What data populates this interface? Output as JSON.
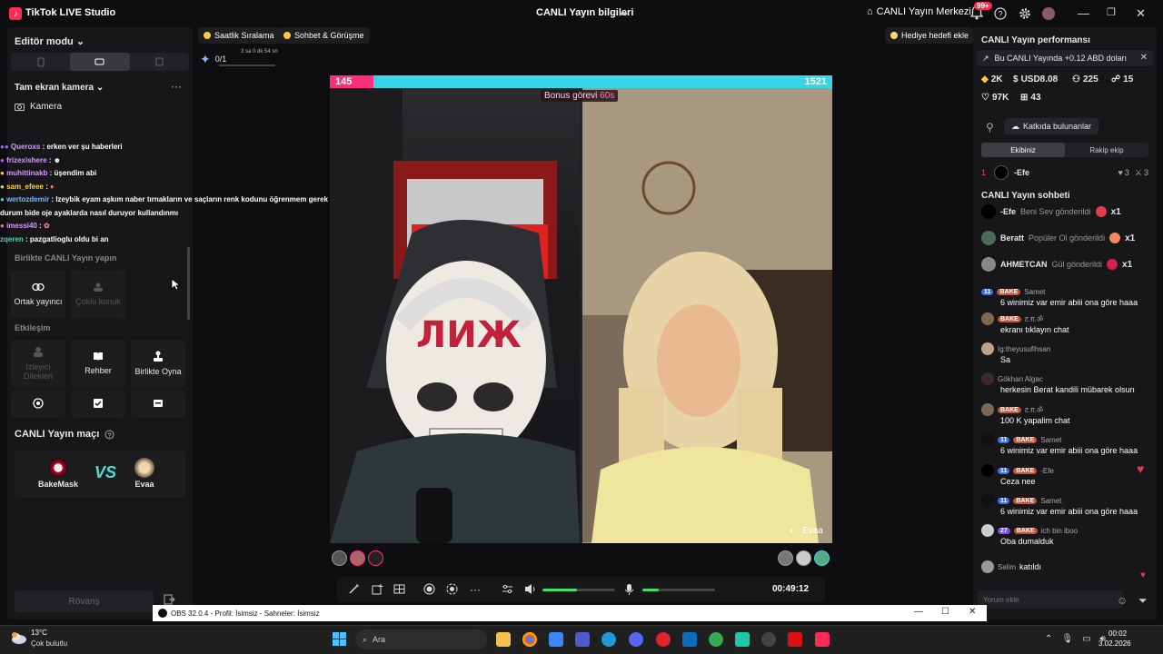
{
  "titlebar": {
    "app_title": "TikTok LIVE Studio",
    "window_title": "CANLI Yayın bilgileri",
    "live_center": "CANLI Yayın Merkezi",
    "notif_count": "99+"
  },
  "left": {
    "editor_mode": "Editör modu",
    "fullscreen_camera": "Tam ekran kamera",
    "camera": "Kamera",
    "collab_title": "Birlikte CANLI Yayın yapın",
    "cohost": "Ortak yayıncı",
    "multi_guest": "Çoklu konuk",
    "interaction_title": "Etkileşim",
    "viewer_requests": "İzleyici Dilekleri",
    "guide": "Rehber",
    "play_together": "Birlikte Oyna",
    "match_title": "CANLI Yayın maçı",
    "player1": "BakeMask",
    "vs": "VS",
    "player2": "Evaa",
    "rematch": "Rövanş"
  },
  "overlay_chat": [
    {
      "user": "Queroxs",
      "text": "erken ver şu haberleri",
      "cls": "u"
    },
    {
      "user": "frizexishere",
      "text": "",
      "cls": "u"
    },
    {
      "user": "muhittinakb",
      "text": "üşendim abi",
      "cls": "u g"
    },
    {
      "user": "sam_efeee",
      "text": "",
      "cls": "u g"
    },
    {
      "user": "wertozdemir",
      "text": "Izeybik eyam aşkım naber tırnakların ve saçların renk kodunu öğrenmem gerek acil",
      "cls": "u b"
    },
    {
      "user": "",
      "text": "durum bide oje ayaklarda nasıl duruyor kullandınmı",
      "cls": "u"
    },
    {
      "user": "imessi40",
      "text": "",
      "cls": "u"
    },
    {
      "user": "zqeren",
      "text": "pazgatlioglu oldu bi an",
      "cls": "u t"
    }
  ],
  "top_pills": {
    "hourly_rank": "Saatlik Sıralama",
    "chat_meet": "Sohbet & Görüşme",
    "goal_counter": "0/1",
    "goal_time": "3 sa 0 dk 54 sn",
    "gift_goal": "Hediye hedefi ekle"
  },
  "stage": {
    "score_left": "145",
    "score_right": "1521",
    "score_left_fraction": 0.087,
    "bonus_label": "Bonus görevi",
    "bonus_time": "60s",
    "guest_name": "Evaa"
  },
  "controls": {
    "volume_level": 0.48,
    "mic_level": 0.22,
    "timer": "00:49:12"
  },
  "right": {
    "perf_title": "CANLI Yayın performansı",
    "earn_banner": "Bu CANLI Yayında +0.12 ABD doları",
    "stat_diamonds": "2K",
    "stat_usd": "USD8.08",
    "stat_viewers": "225",
    "stat_followers": "15",
    "stat_likes": "97K",
    "stat_gifts": "43",
    "contributors": "Katkıda bulunanlar",
    "tab_team": "Ekibiniz",
    "tab_rival": "Rakip ekip",
    "rank_num": "1",
    "rank_name": "-Efe",
    "rank_hearts": "3",
    "rank_extra": "3",
    "chat_title": "CANLI Yayın sohbeti",
    "gifts": [
      {
        "user": "-Efe",
        "desc": "Beni Sev gönderildi",
        "count": "x1"
      },
      {
        "user": "Beratt",
        "desc": "Popüler Ol gönderildi",
        "count": "x1"
      },
      {
        "user": "AHMETCAN",
        "desc": "Gül gönderildi",
        "count": "x1"
      }
    ],
    "messages": [
      {
        "name": "Samet",
        "badge": "11",
        "badge2": "BAKE",
        "text": "6 winimiz var emir abiii ona göre haaa"
      },
      {
        "name": "ट.ग़.ॐ",
        "badge": "",
        "badge2": "BAKE",
        "text": "ekranı tıklayın chat"
      },
      {
        "name": "Ig:theyusufihsan",
        "badge": "",
        "badge2": "",
        "text": "Sa"
      },
      {
        "name": "Gökhan Algac",
        "badge": "",
        "badge2": "",
        "text": "herkesin Berat kandili mübarek olsun"
      },
      {
        "name": "ट.ग़.ॐ",
        "badge": "",
        "badge2": "BAKE",
        "text": "100 K yapalim chat"
      },
      {
        "name": "Samet",
        "badge": "11",
        "badge2": "BAKE",
        "text": "6 winimiz var emir abiii ona göre haaa"
      },
      {
        "name": "-Efe",
        "badge": "11",
        "badge2": "BAKE",
        "text": "Ceza nee"
      },
      {
        "name": "Samet",
        "badge": "11",
        "badge2": "BAKE",
        "text": "6 winimiz var emir abiii ona göre haaa"
      },
      {
        "name": "ich bin iboo",
        "badge": "27",
        "badge2": "BAKE",
        "text": "Oba dumalduk"
      }
    ],
    "joined_user": "Selim",
    "joined_text": "katıldı",
    "input_placeholder": "Yorum ekle"
  },
  "obs": {
    "title": "OBS 32.0.4 - Profil: İsimsiz - Sahneler: İsimsiz"
  },
  "taskbar": {
    "temp": "13°C",
    "weather": "Çok bulutlu",
    "search": "Ara",
    "time": "00:02",
    "date": "3.02.2026"
  }
}
